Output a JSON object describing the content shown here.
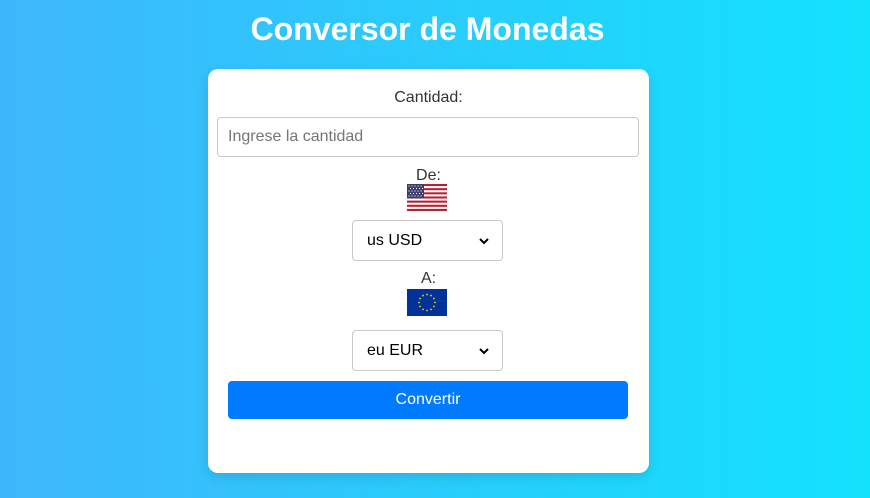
{
  "page": {
    "title": "Conversor de Monedas"
  },
  "form": {
    "amount_label": "Cantidad:",
    "amount_placeholder": "Ingrese la cantidad",
    "amount_value": "",
    "from_label": "De:",
    "from_flag_icon": "us-flag-icon",
    "from_selected": "us USD",
    "to_label": "A:",
    "to_flag_icon": "eu-flag-icon",
    "to_selected": "eu EUR",
    "convert_label": "Convertir"
  },
  "colors": {
    "background_start": "#3fb6fb",
    "background_end": "#13e2fd",
    "button": "#007bff",
    "card": "#ffffff"
  }
}
